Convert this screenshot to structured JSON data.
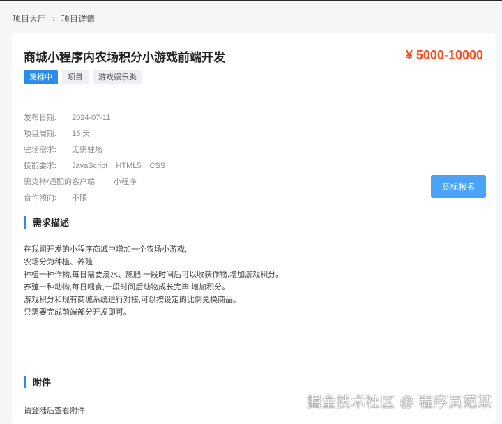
{
  "breadcrumb": {
    "items": [
      "项目大厅",
      "项目详情"
    ],
    "separator_icon": "chevron-right-icon"
  },
  "project": {
    "title": "商城小程序内农场积分小游戏前端开发",
    "price": "¥ 5000-10000",
    "tags": [
      {
        "label": "竞标中",
        "color": "#2a8de8"
      },
      {
        "label": "项目"
      },
      {
        "label": "游戏娱乐类"
      }
    ]
  },
  "info": {
    "publish_date": {
      "label": "发布日期:",
      "value": "2024-07-11"
    },
    "period": {
      "label": "项目周期:",
      "value": "15 天"
    },
    "onsite": {
      "label": "驻场需求:",
      "value": "无需驻场"
    },
    "skills": {
      "label": "技能要求:",
      "values": [
        "JavaScript",
        "HTML5",
        "CSS"
      ]
    },
    "clients": {
      "label": "需支持/适配的客户端:",
      "value": "小程序"
    },
    "cooperation": {
      "label": "合作倾向:",
      "value": "不限"
    }
  },
  "apply_button": "竞标报名",
  "requirement": {
    "heading": "需求描述",
    "lines": [
      "在我司开发的小程序商城中增加一个农场小游戏,",
      "农场分为种植、养殖",
      "种植一种作物,每日需要浇水、施肥,一段时间后可以收获作物,增加游戏积分。",
      "养殖一种动物,每日喂食,一段时间后动物成长完毕,增加积分。",
      "游戏积分和现有商城系统进行对接,可以按设定的比例兑换商品。",
      "只需要完成前端部分开发即可。"
    ]
  },
  "attachments": {
    "heading": "附件",
    "note": "请登陆后查看附件"
  },
  "watermark": "掘金技术社区 @ 程序员范某",
  "colors": {
    "accent": "#2a8de8",
    "price": "#ff4b1f",
    "button": "#4aa3f7"
  }
}
